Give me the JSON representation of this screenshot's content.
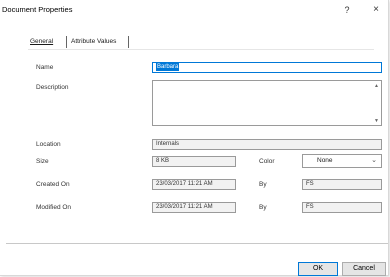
{
  "window": {
    "title": "Document Properties",
    "help_glyph": "?",
    "close_glyph": "×"
  },
  "tabs": [
    {
      "label": "General",
      "selected": true
    },
    {
      "label": "Attribute Values",
      "selected": false
    }
  ],
  "form": {
    "name": {
      "label": "Name",
      "value": "Barbara"
    },
    "description": {
      "label": "Description",
      "value": ""
    },
    "location": {
      "label": "Location",
      "value": "Internals"
    },
    "size": {
      "label": "Size",
      "value": "8 KB"
    },
    "color": {
      "label": "Color",
      "value": "None"
    },
    "created_on": {
      "label": "Created On",
      "value": "23/03/2017 11:21 AM",
      "by_label": "By",
      "by_value": "FS"
    },
    "modified_on": {
      "label": "Modified On",
      "value": "23/03/2017 11:21 AM",
      "by_label": "By",
      "by_value": "FS"
    }
  },
  "buttons": {
    "ok": "OK",
    "cancel": "Cancel"
  },
  "accent_color": "#0078d7"
}
